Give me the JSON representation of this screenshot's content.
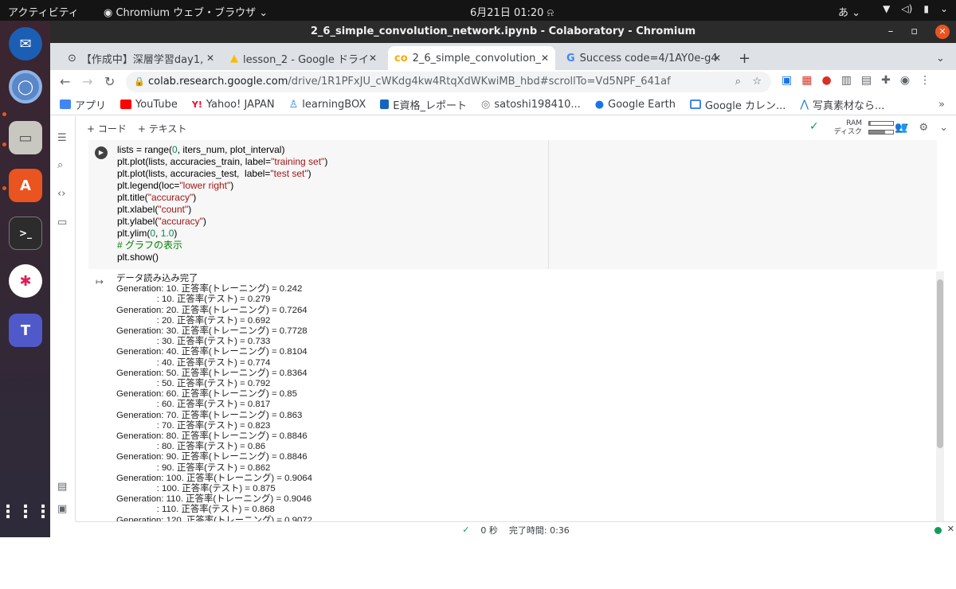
{
  "system_bar": {
    "activities": "アクティビティ",
    "app_menu": "Chromium ウェブ・ブラウザ",
    "clock": "6月21日  01:20",
    "ime": "あ"
  },
  "window": {
    "title": "2_6_simple_convolution_network.ipynb - Colaboratory - Chromium"
  },
  "tabs": [
    {
      "label": "【作成中】深層学習day1,"
    },
    {
      "label": "lesson_2 - Google ドライ"
    },
    {
      "label": "2_6_simple_convolution_"
    },
    {
      "label": "Success code=4/1AY0e-g4"
    }
  ],
  "address": {
    "host": "colab.research.google.com",
    "path": "/drive/1R1PFxJU_cWKdg4kw4RtqXdWKwiMB_hbd#scrollTo=Vd5NPF_641af"
  },
  "bookmarks": [
    {
      "label": "アプリ",
      "color": "#4285f4"
    },
    {
      "label": "YouTube",
      "color": "#ff0000"
    },
    {
      "label": "Yahoo! JAPAN",
      "color": "#ff0033"
    },
    {
      "label": "learningBOX",
      "color": "#1e88e5"
    },
    {
      "label": "E資格_レポート",
      "color": "#1565c0"
    },
    {
      "label": "satoshi198410...",
      "color": "#757575"
    },
    {
      "label": "Google Earth",
      "color": "#1a73e8"
    },
    {
      "label": "Google カレン...",
      "color": "#4285f4"
    },
    {
      "label": "写真素材なら...",
      "color": "#1976d2"
    }
  ],
  "colab": {
    "add_code": "+ コード",
    "add_text": "+ テキスト",
    "ram_label": "RAM",
    "disk_label": "ディスク",
    "ram_usage": 0.08,
    "disk_usage": 0.65
  },
  "code_lines": [
    "lists = range(0, iters_num, plot_interval)",
    "plt.plot(lists, accuracies_train, label=\"training set\")",
    "plt.plot(lists, accuracies_test,  label=\"test set\")",
    "plt.legend(loc=\"lower right\")",
    "plt.title(\"accuracy\")",
    "plt.xlabel(\"count\")",
    "plt.ylabel(\"accuracy\")",
    "plt.ylim(0, 1.0)",
    "# グラフの表示",
    "plt.show()"
  ],
  "output_lines": [
    "データ読み込み完了",
    "Generation: 10. 正答率(トレーニング) = 0.242",
    "                : 10. 正答率(テスト) = 0.279",
    "Generation: 20. 正答率(トレーニング) = 0.7264",
    "                : 20. 正答率(テスト) = 0.692",
    "Generation: 30. 正答率(トレーニング) = 0.7728",
    "                : 30. 正答率(テスト) = 0.733",
    "Generation: 40. 正答率(トレーニング) = 0.8104",
    "                : 40. 正答率(テスト) = 0.774",
    "Generation: 50. 正答率(トレーニング) = 0.8364",
    "                : 50. 正答率(テスト) = 0.792",
    "Generation: 60. 正答率(トレーニング) = 0.85",
    "                : 60. 正答率(テスト) = 0.817",
    "Generation: 70. 正答率(トレーニング) = 0.863",
    "                : 70. 正答率(テスト) = 0.823",
    "Generation: 80. 正答率(トレーニング) = 0.8846",
    "                : 80. 正答率(テスト) = 0.86",
    "Generation: 90. 正答率(トレーニング) = 0.8846",
    "                : 90. 正答率(テスト) = 0.862",
    "Generation: 100. 正答率(トレーニング) = 0.9064",
    "                : 100. 正答率(テスト) = 0.875",
    "Generation: 110. 正答率(トレーニング) = 0.9046",
    "                : 110. 正答率(テスト) = 0.868",
    "Generation: 120. 正答率(トレーニング) = 0.9072"
  ],
  "status": {
    "seconds": "0 秒",
    "completed": "完了時間: 0:36"
  }
}
